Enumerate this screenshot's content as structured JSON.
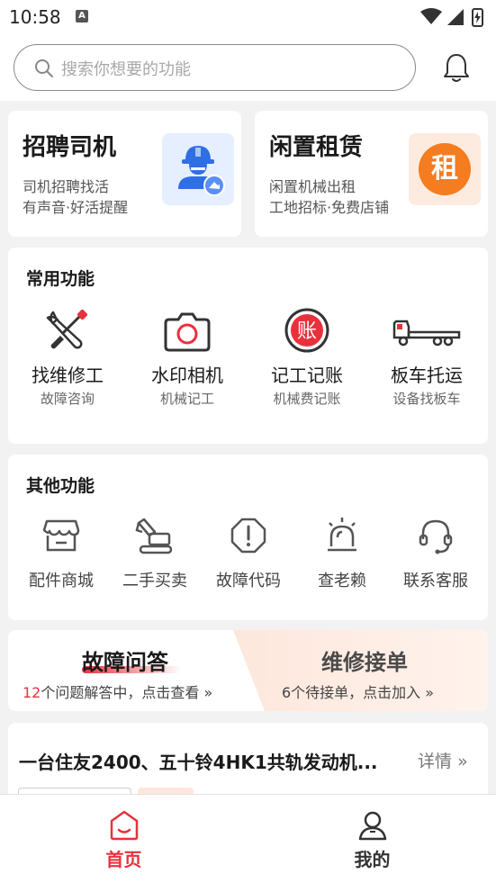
{
  "status_bar": {
    "time": "10:58",
    "notif_letter": "A"
  },
  "search": {
    "placeholder": "搜索你想要的功能"
  },
  "promos": [
    {
      "title": "招聘司机",
      "line1": "司机招聘找活",
      "line2": "有声音·好活提醒",
      "icon": "driver-worker-icon"
    },
    {
      "title": "闲置租赁",
      "line1": "闲置机械出租",
      "line2": "工地招标·免费店铺",
      "icon": "rent-badge-icon",
      "badge": "租"
    }
  ],
  "common": {
    "title": "常用功能",
    "items": [
      {
        "label": "找维修工",
        "sub": "故障咨询",
        "icon": "wrench-screwdriver-icon"
      },
      {
        "label": "水印相机",
        "sub": "机械记工",
        "icon": "camera-icon"
      },
      {
        "label": "记工记账",
        "sub": "机械费记账",
        "icon": "ledger-icon",
        "glyph": "账"
      },
      {
        "label": "板车托运",
        "sub": "设备找板车",
        "icon": "flatbed-truck-icon"
      }
    ]
  },
  "other": {
    "title": "其他功能",
    "items": [
      {
        "label": "配件商城",
        "icon": "store-icon"
      },
      {
        "label": "二手买卖",
        "icon": "excavator-icon"
      },
      {
        "label": "故障代码",
        "icon": "warning-octagon-icon"
      },
      {
        "label": "查老赖",
        "icon": "alarm-light-icon"
      },
      {
        "label": "联系客服",
        "icon": "headset-icon"
      }
    ]
  },
  "qa": {
    "left_title": "故障问答",
    "left_count": "12",
    "left_sub": "个问题解答中，点击查看",
    "right_title": "维修接单",
    "right_sub": "6个待接单，点击加入"
  },
  "news": {
    "title": "一台住友2400、五十铃4HK1共轨发动机...",
    "more": "详情"
  },
  "tabs": [
    {
      "label": "首页",
      "icon": "home-icon",
      "active": true
    },
    {
      "label": "我的",
      "icon": "user-icon",
      "active": false
    }
  ],
  "colors": {
    "accent": "#e8313d",
    "orange": "#f57c1f",
    "blue": "#2f6fe4"
  }
}
